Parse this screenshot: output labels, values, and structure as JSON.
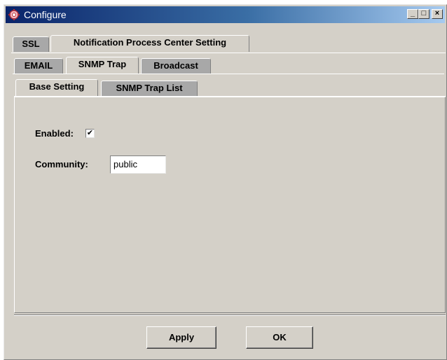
{
  "window": {
    "title": "Configure",
    "minimize_glyph": "_",
    "maximize_glyph": "□",
    "close_glyph": "×",
    "icon": "app-gear-icon"
  },
  "tabs_level1": [
    {
      "label": "SSL",
      "selected": false
    },
    {
      "label": "Notification Process Center Setting",
      "selected": true
    }
  ],
  "tabs_level2": [
    {
      "label": "EMAIL",
      "selected": false
    },
    {
      "label": "SNMP Trap",
      "selected": true
    },
    {
      "label": "Broadcast",
      "selected": false
    }
  ],
  "tabs_level3": [
    {
      "label": "Base Setting",
      "selected": true
    },
    {
      "label": "SNMP Trap List",
      "selected": false
    }
  ],
  "form": {
    "enabled_label": "Enabled:",
    "enabled_checked": true,
    "check_glyph": "✔",
    "community_label": "Community:",
    "community_value": "public"
  },
  "buttons": {
    "apply": "Apply",
    "ok": "OK"
  }
}
